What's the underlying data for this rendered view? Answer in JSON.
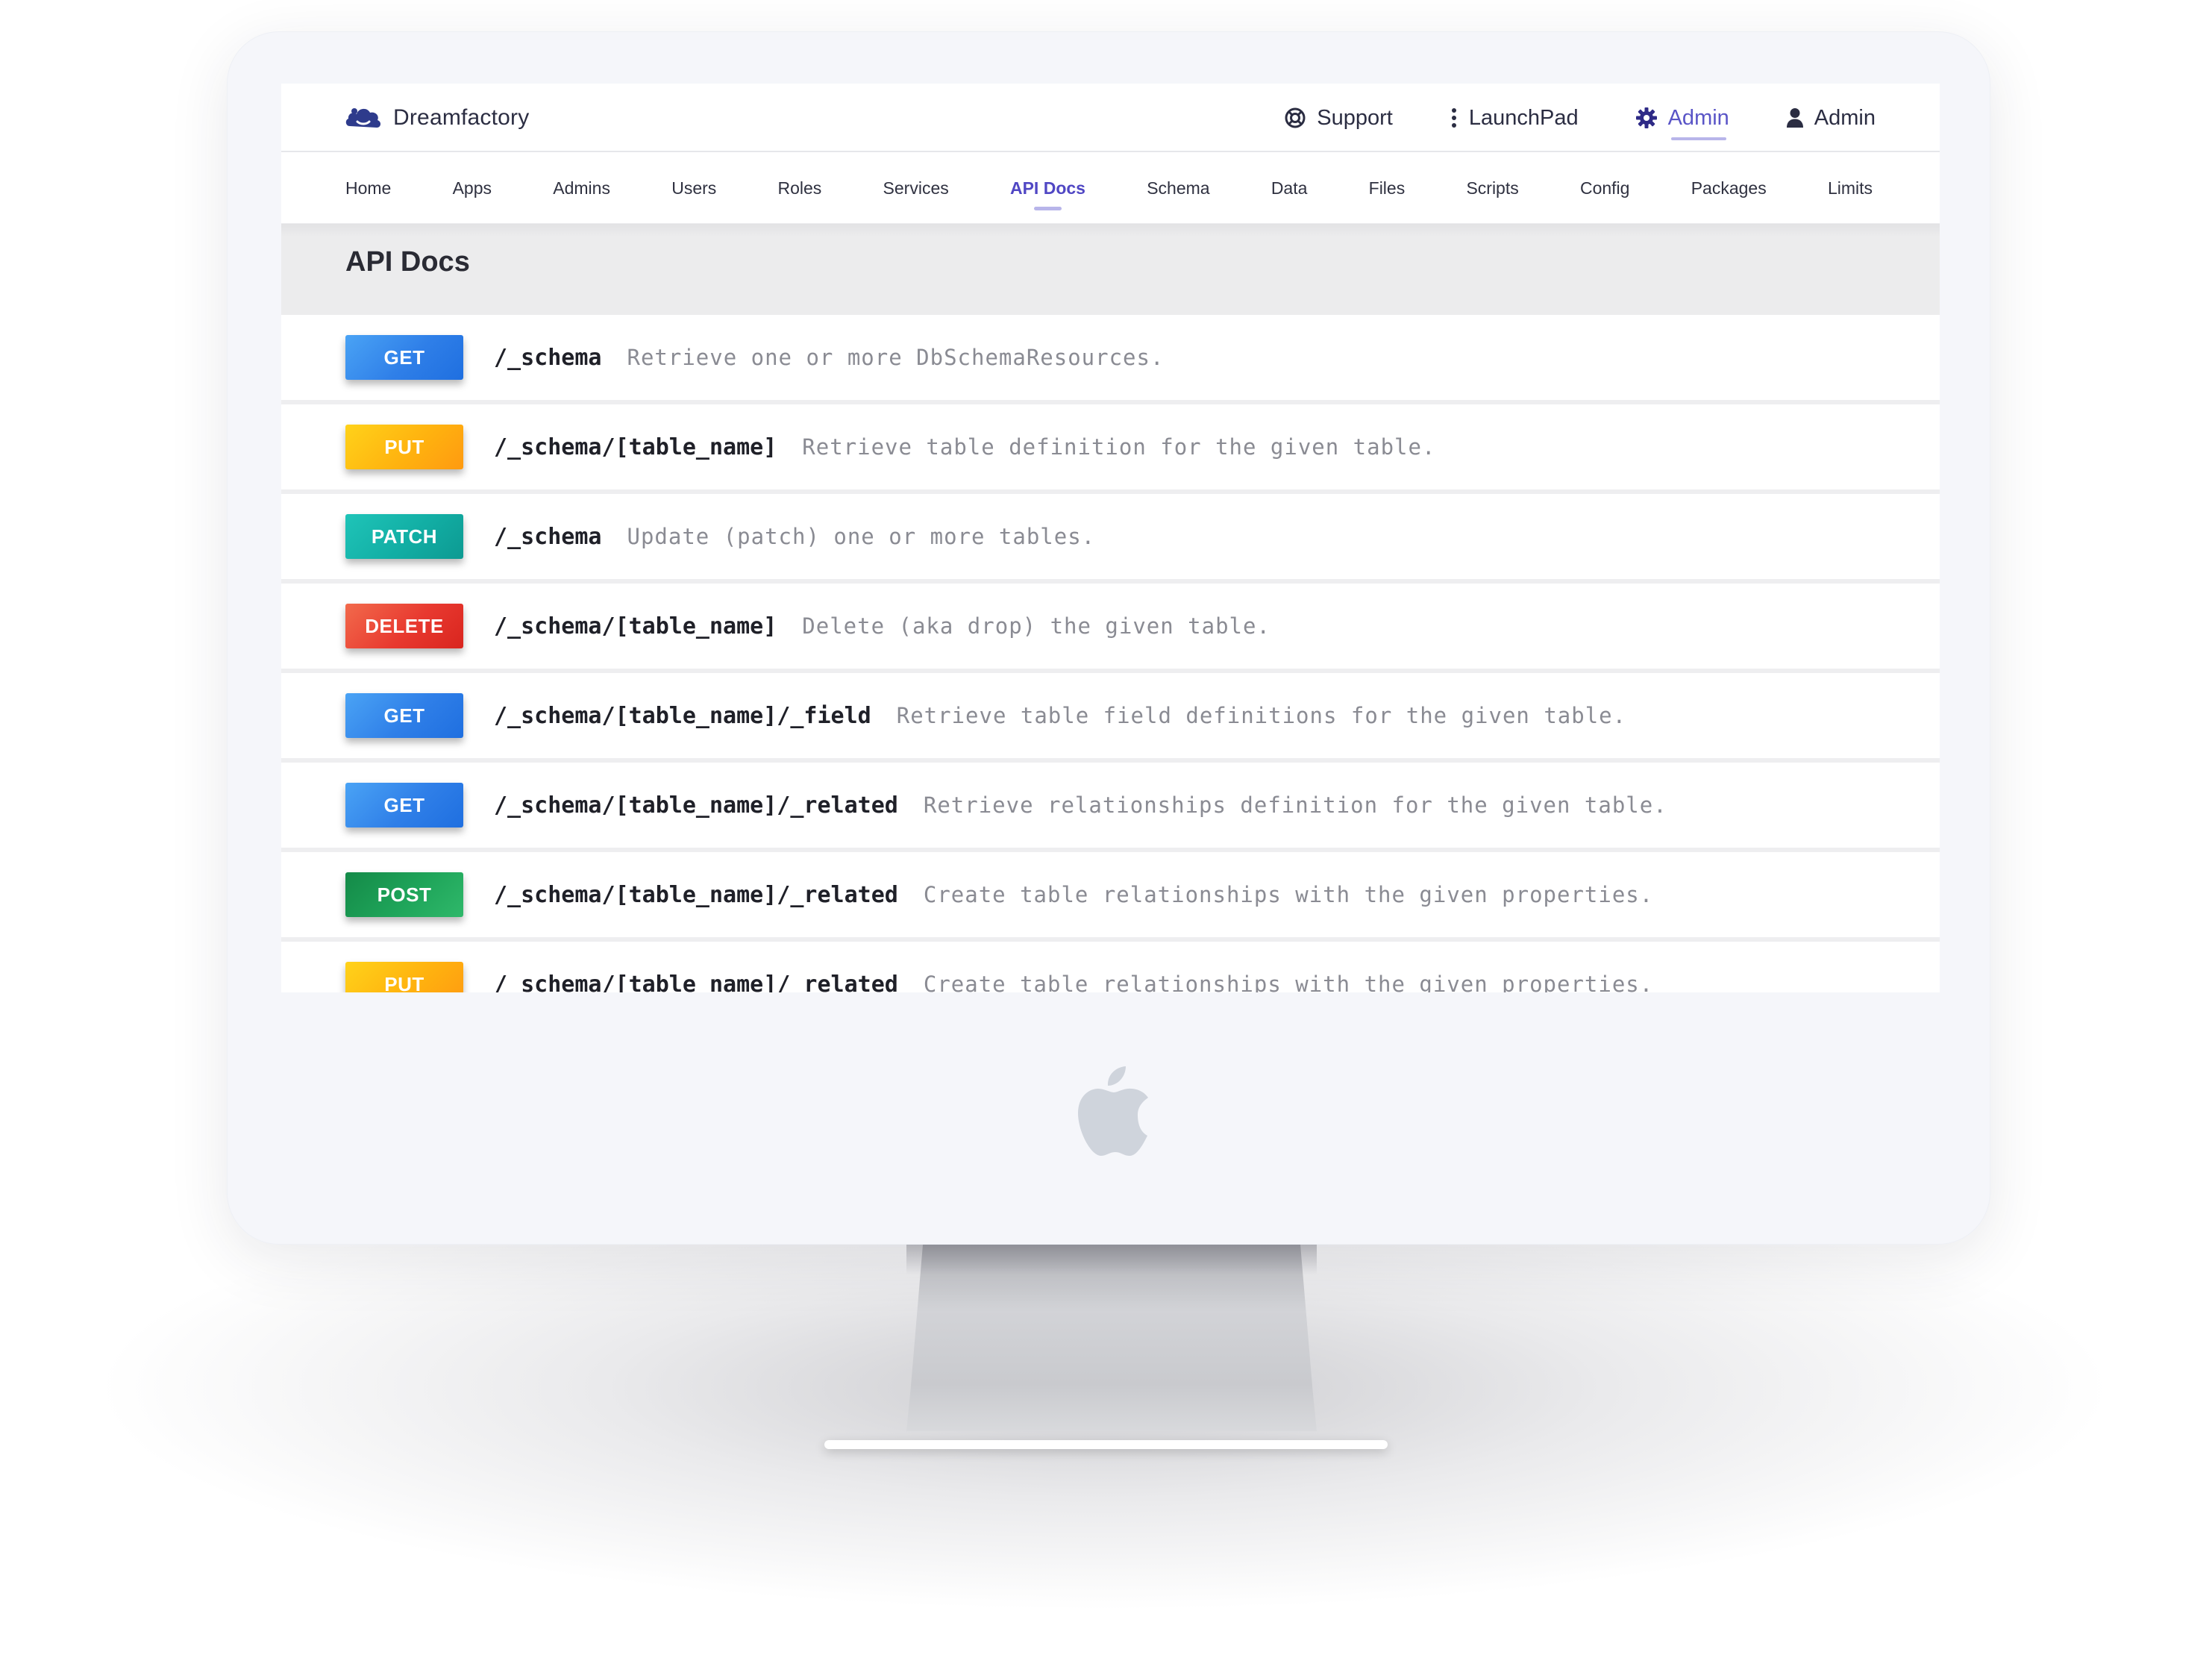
{
  "app": {
    "brand": "Dreamfactory"
  },
  "top_menu": [
    {
      "label": "Support",
      "icon": "lifebuoy-icon"
    },
    {
      "label": "LaunchPad",
      "icon": "vertical-dots-icon"
    },
    {
      "label": "Admin",
      "icon": "gear-icon",
      "active": true
    },
    {
      "label": "Admin",
      "icon": "user-icon"
    }
  ],
  "nav": [
    {
      "label": "Home"
    },
    {
      "label": "Apps"
    },
    {
      "label": "Admins"
    },
    {
      "label": "Users"
    },
    {
      "label": "Roles"
    },
    {
      "label": "Services"
    },
    {
      "label": "API Docs",
      "active": true
    },
    {
      "label": "Schema"
    },
    {
      "label": "Data"
    },
    {
      "label": "Files"
    },
    {
      "label": "Scripts"
    },
    {
      "label": "Config"
    },
    {
      "label": "Packages"
    },
    {
      "label": "Limits"
    }
  ],
  "page": {
    "title": "API Docs"
  },
  "endpoints": [
    {
      "method": "GET",
      "path": "/_schema",
      "description": "Retrieve one or more DbSchemaResources."
    },
    {
      "method": "PUT",
      "path": "/_schema/[table_name]",
      "description": "Retrieve table definition for the given table."
    },
    {
      "method": "PATCH",
      "path": "/_schema",
      "description": "Update (patch) one or more tables."
    },
    {
      "method": "DELETE",
      "path": "/_schema/[table_name]",
      "description": "Delete (aka drop) the given table."
    },
    {
      "method": "GET",
      "path": "/_schema/[table_name]/_field",
      "description": "Retrieve table field definitions for the given table."
    },
    {
      "method": "GET",
      "path": "/_schema/[table_name]/_related",
      "description": "Retrieve relationships definition for the given table."
    },
    {
      "method": "POST",
      "path": "/_schema/[table_name]/_related",
      "description": "Create table relationships with the given properties."
    },
    {
      "method": "PUT",
      "path": "/_schema/[table_name]/_related",
      "description": "Create table relationships with the given properties."
    }
  ],
  "colors": {
    "accent": "#5a55c7",
    "get": "#2f7fe8",
    "put": "#ffb30f",
    "patch": "#12aea4",
    "delete": "#e8392f",
    "post": "#1fa55a"
  }
}
